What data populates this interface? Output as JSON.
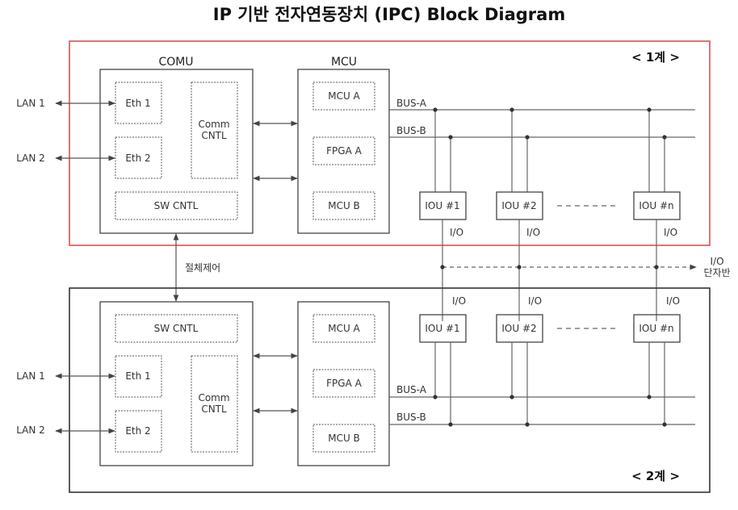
{
  "title": "IP 기반 전자연동장치 (IPC) Block Diagram",
  "systems": [
    {
      "label": "< 1계 >",
      "border_color": "#d9534f",
      "comu": {
        "header": "COMU",
        "lan1": "LAN 1",
        "lan2": "LAN 2",
        "eth1": "Eth 1",
        "eth2": "Eth 2",
        "comm_line1": "Comm",
        "comm_line2": "CNTL",
        "sw": "SW CNTL"
      },
      "mcu": {
        "header": "MCU",
        "mcu_a": "MCU A",
        "fpga_a": "FPGA A",
        "mcu_b": "MCU B"
      },
      "bus_a": "BUS-A",
      "bus_b": "BUS-B",
      "ious": [
        "IOU #1",
        "IOU #2",
        "IOU #n"
      ],
      "io_label": "I/O"
    },
    {
      "label": "< 2계 >",
      "border_color": "#333333",
      "comu": {
        "lan1": "LAN 1",
        "lan2": "LAN 2",
        "eth1": "Eth 1",
        "eth2": "Eth 2",
        "comm_line1": "Comm",
        "comm_line2": "CNTL",
        "sw": "SW CNTL"
      },
      "mcu": {
        "mcu_a": "MCU A",
        "fpga_a": "FPGA A",
        "mcu_b": "MCU B"
      },
      "bus_a": "BUS-A",
      "bus_b": "BUS-B",
      "ious": [
        "IOU #1",
        "IOU #2",
        "IOU #n"
      ],
      "io_label": "I/O"
    }
  ],
  "switch_control": "절체제어",
  "io_terminal_line1": "I/O",
  "io_terminal_line2": "단자반"
}
